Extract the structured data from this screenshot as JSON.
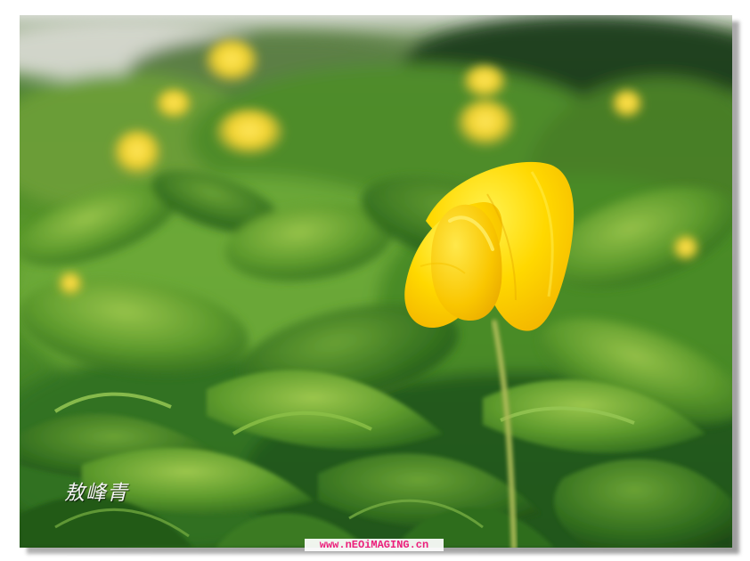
{
  "image": {
    "subject": "yellow-flower",
    "colors": {
      "petal": "#ffd400",
      "petal_highlight": "#fff34a",
      "foliage_dark": "#21561a",
      "foliage_light": "#80b53a",
      "stem": "#8fa640"
    }
  },
  "overlays": {
    "signature": "敖峰青",
    "watermark": "www.nEOiMAGING.cn"
  }
}
